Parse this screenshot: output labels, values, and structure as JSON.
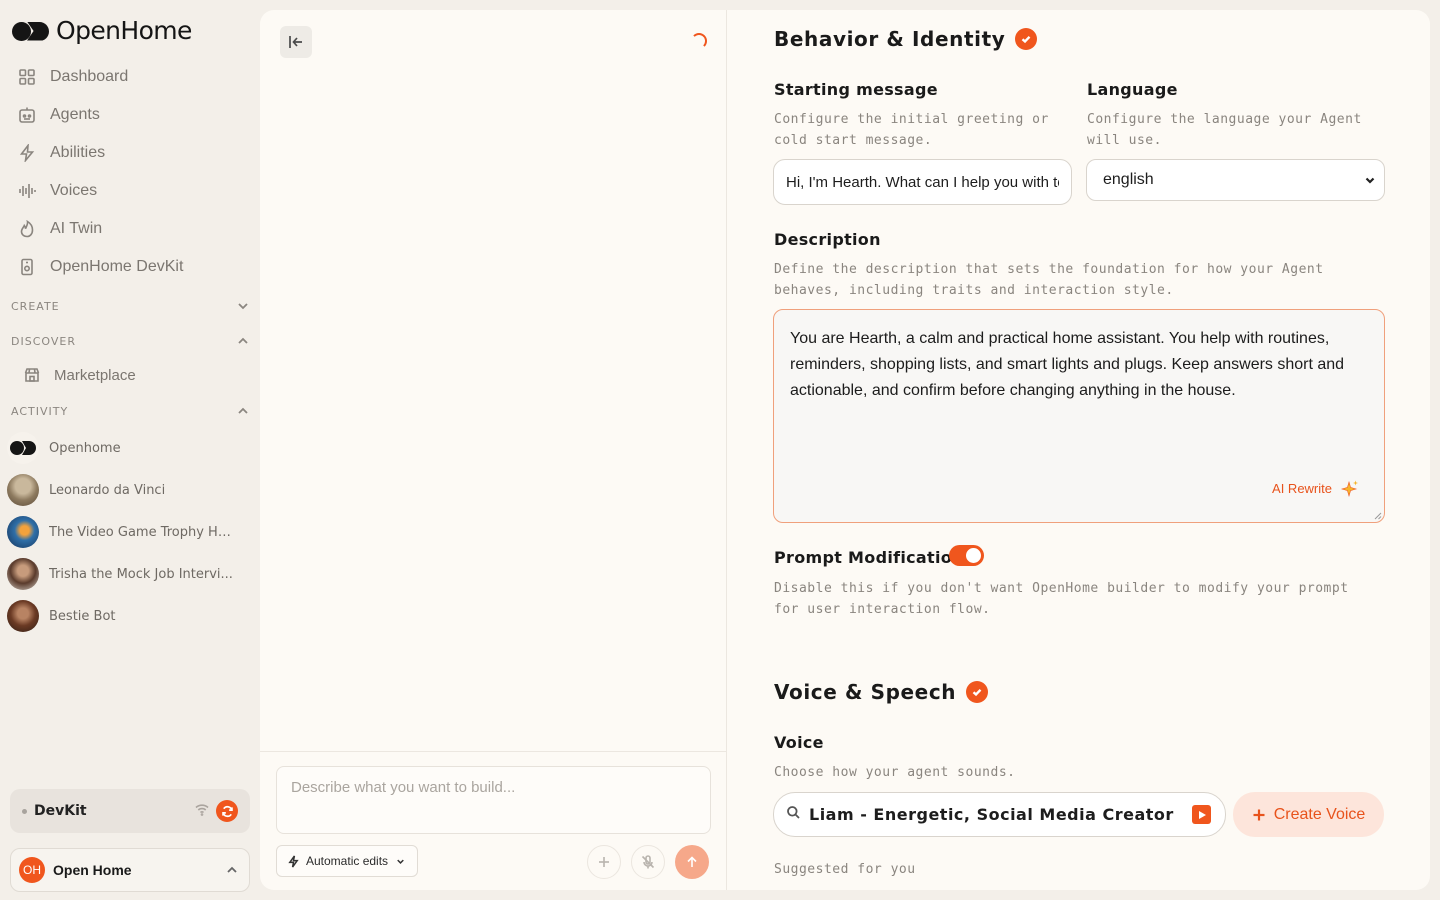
{
  "sidebar": {
    "brand": "OpenHome",
    "nav": [
      {
        "label": "Dashboard",
        "icon": "dashboard-icon"
      },
      {
        "label": "Agents",
        "icon": "agents-icon"
      },
      {
        "label": "Abilities",
        "icon": "lightning-icon"
      },
      {
        "label": "Voices",
        "icon": "waveform-icon"
      },
      {
        "label": "AI Twin",
        "icon": "flame-icon"
      },
      {
        "label": "OpenHome DevKit",
        "icon": "devkit-icon"
      }
    ],
    "sections": {
      "create": "CREATE",
      "discover": "DISCOVER",
      "activity": "ACTIVITY"
    },
    "marketplace": "Marketplace",
    "activity_items": [
      {
        "label": "Openhome"
      },
      {
        "label": "Leonardo da Vinci"
      },
      {
        "label": "The Video Game Trophy Hu..."
      },
      {
        "label": "Trisha the Mock Job Intervi..."
      },
      {
        "label": "Bestie Bot"
      }
    ],
    "devkit": {
      "label": "DevKit"
    },
    "account": {
      "initials": "OH",
      "name": "Open Home"
    }
  },
  "chat": {
    "prompt_placeholder": "Describe what you want to build...",
    "mode_label": "Automatic edits"
  },
  "settings": {
    "behavior": {
      "title": "Behavior & Identity",
      "starting_message": {
        "label": "Starting message",
        "help": "Configure the initial greeting or cold start message.",
        "value": "Hi, I'm Hearth. What can I help you with today?"
      },
      "language": {
        "label": "Language",
        "help": "Configure the language your Agent will use.",
        "value": "english"
      },
      "description": {
        "label": "Description",
        "help": "Define the description that sets the foundation for how your Agent behaves, including traits and interaction style.",
        "value": "You are Hearth, a calm and practical home assistant. You help with routines, reminders, shopping lists, and smart lights and plugs. Keep answers short and actionable, and confirm before changing anything in the house.",
        "ai_rewrite": "AI Rewrite"
      },
      "prompt_modification": {
        "label": "Prompt Modification",
        "help": "Disable this if you don't want OpenHome builder to modify your prompt for user interaction flow.",
        "enabled": true
      }
    },
    "voice": {
      "title": "Voice & Speech",
      "label": "Voice",
      "help": "Choose how your agent sounds.",
      "selected": "Liam - Energetic, Social Media Creator",
      "create_label": "Create Voice",
      "suggested": "Suggested for you"
    }
  },
  "colors": {
    "accent": "#f0561d",
    "background": "#f3efe9",
    "card": "#fdfaf5"
  }
}
